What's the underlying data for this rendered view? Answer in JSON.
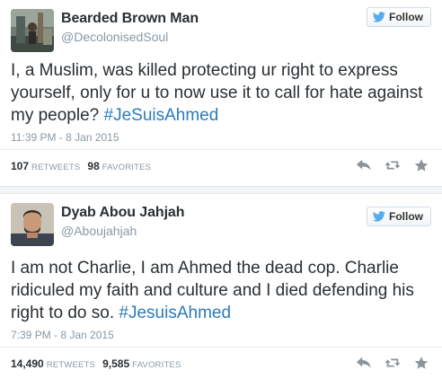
{
  "colors": {
    "text": "#292f33",
    "muted": "#8899a6",
    "link": "#2b7bb9",
    "twitter_blue": "#55acee",
    "action_gray": "#8a949b"
  },
  "tweets": [
    {
      "author_name": "Bearded Brown Man",
      "handle": "@DecolonisedSoul",
      "follow_label": "Follow",
      "text": "I, a Muslim, was killed protecting ur right to express yourself, only for u to now use it to call for hate against my people? ",
      "hashtag": "#JeSuisAhmed",
      "timestamp": "11:39 PM - 8 Jan 2015",
      "retweets_count": "107",
      "retweets_label": "RETWEETS",
      "favorites_count": "98",
      "favorites_label": "FAVORITES",
      "icons": [
        "reply-icon",
        "retweet-icon",
        "favorite-star-icon"
      ]
    },
    {
      "author_name": "Dyab Abou Jahjah",
      "handle": "@Aboujahjah",
      "follow_label": "Follow",
      "text": "I am not Charlie, I am Ahmed the dead cop. Charlie ridiculed my faith and culture and I died defending his right to do so. ",
      "hashtag": "#JesuisAhmed",
      "timestamp": "7:39 PM - 8 Jan 2015",
      "retweets_count": "14,490",
      "retweets_label": "RETWEETS",
      "favorites_count": "9,585",
      "favorites_label": "FAVORITES",
      "icons": [
        "reply-icon",
        "retweet-icon",
        "favorite-star-icon"
      ]
    }
  ]
}
